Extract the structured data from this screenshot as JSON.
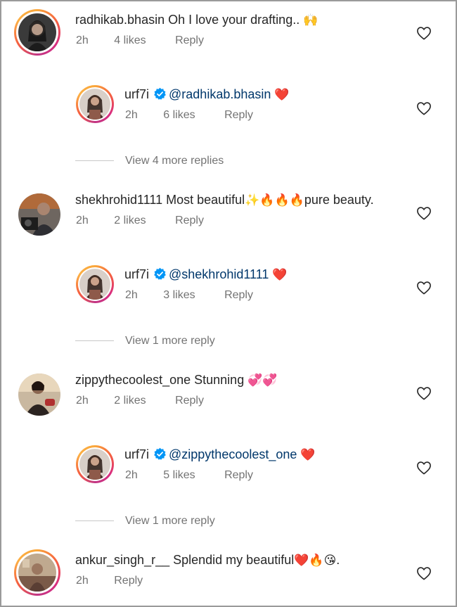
{
  "comments": [
    {
      "username": "radhikab.bhasin",
      "text": "Oh I love your drafting.. ",
      "emoji": "🙌",
      "time": "2h",
      "likes": "4 likes",
      "reply": "Reply",
      "reply_item": {
        "username": "urf7i",
        "mention": "@radhikab.bhasin",
        "emoji": "❤️",
        "time": "2h",
        "likes": "6 likes",
        "reply": "Reply"
      },
      "view_more": "View 4 more replies"
    },
    {
      "username": "shekhrohid1111",
      "text": "Most beautiful",
      "emoji": "✨🔥🔥🔥",
      "text2": "pure beauty.",
      "time": "2h",
      "likes": "2 likes",
      "reply": "Reply",
      "reply_item": {
        "username": "urf7i",
        "mention": "@shekhrohid1111",
        "emoji": "❤️",
        "time": "2h",
        "likes": "3 likes",
        "reply": "Reply"
      },
      "view_more": "View 1 more reply"
    },
    {
      "username": "zippythecoolest_one",
      "text": "Stunning ",
      "emoji": "💞💞",
      "time": "2h",
      "likes": "2 likes",
      "reply": "Reply",
      "reply_item": {
        "username": "urf7i",
        "mention": "@zippythecoolest_one",
        "emoji": "❤️",
        "time": "2h",
        "likes": "5 likes",
        "reply": "Reply"
      },
      "view_more": "View 1 more reply"
    },
    {
      "username": "ankur_singh_r__",
      "text": "Splendid my beautiful",
      "emoji": "❤️🔥😘",
      "text2": ".",
      "time": "2h",
      "reply": "Reply"
    }
  ],
  "colors": {
    "text": "#262626",
    "meta": "#737373",
    "mention": "#00376b",
    "verified": "#0095f6"
  },
  "icons": {
    "like": "heart-outline-icon",
    "verified": "verified-badge-icon"
  }
}
